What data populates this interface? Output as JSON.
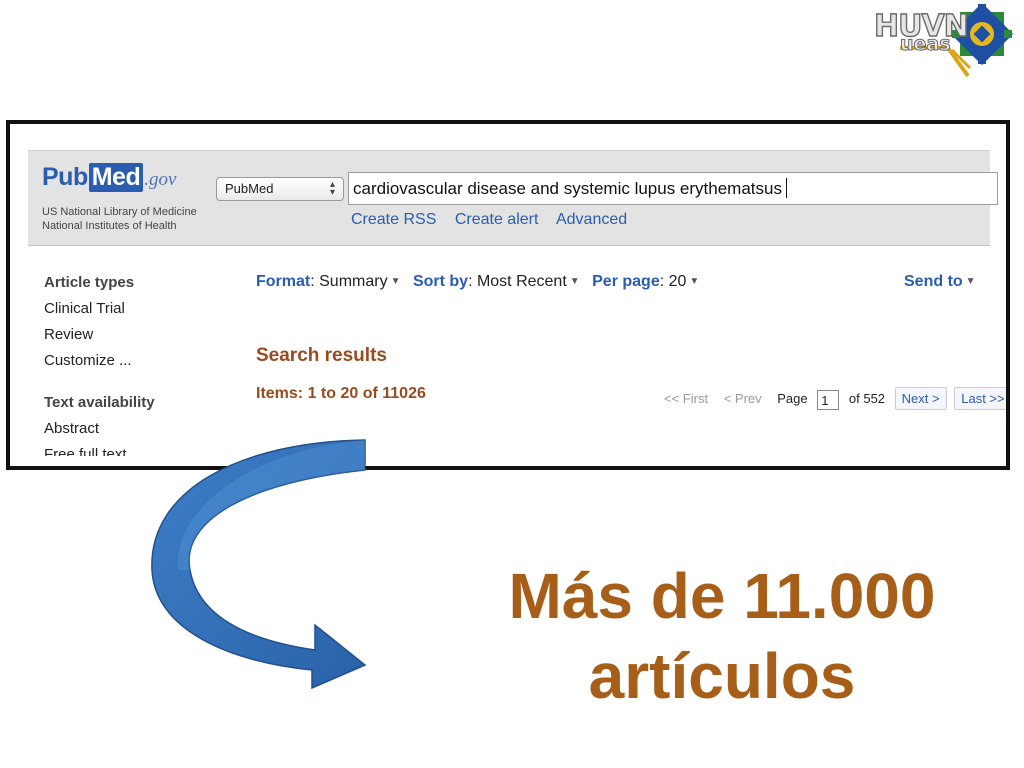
{
  "logo": {
    "text": "HUVN",
    "sub": "ueas"
  },
  "pubmed": {
    "brand_pub": "Pub",
    "brand_med": "Med",
    "brand_gov": ".gov",
    "org_line1": "US National Library of Medicine",
    "org_line2": "National Institutes of Health",
    "db_select": "PubMed",
    "search_query": "cardiovascular disease and systemic lupus erythematsus",
    "links": [
      "Create RSS",
      "Create alert",
      "Advanced"
    ]
  },
  "sidebar": {
    "article_types_heading": "Article types",
    "article_types": [
      "Clinical Trial",
      "Review",
      "Customize ..."
    ],
    "text_availability_heading": "Text availability",
    "text_availability": [
      "Abstract",
      "Free full text"
    ]
  },
  "toolbar": {
    "format_label": "Format",
    "format_value": "Summary",
    "sort_label": "Sort by",
    "sort_value": "Most Recent",
    "perpage_label": "Per page",
    "perpage_value": "20",
    "send_to": "Send to"
  },
  "results": {
    "title": "Search results",
    "items": "Items: 1 to 20 of 11026"
  },
  "pager": {
    "first": "<< First",
    "prev": "< Prev",
    "page_label": "Page",
    "page_value": "1",
    "of_label": "of 552",
    "next": "Next >",
    "last": "Last >>"
  },
  "caption": {
    "line1": "Más de 11.000",
    "line2": "artículos"
  },
  "colors": {
    "pubmed_blue": "#2a5db0",
    "results_brown": "#9a4a1f",
    "caption_brown": "#a65e18",
    "arrow_blue": "#2f6db5"
  }
}
